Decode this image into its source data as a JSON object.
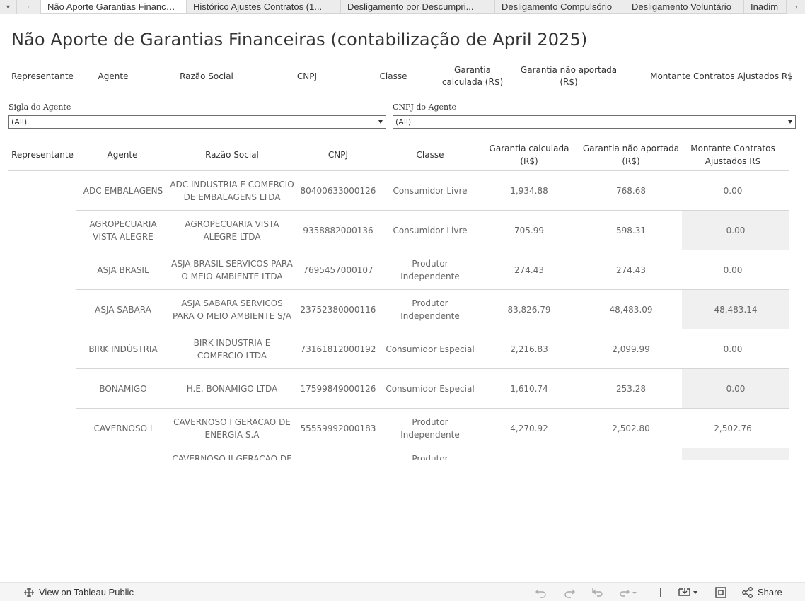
{
  "tabs": [
    {
      "label": "Não Aporte Garantias Financei..."
    },
    {
      "label": "Histórico Ajustes Contratos (1..."
    },
    {
      "label": "Desligamento por Descumpri..."
    },
    {
      "label": "Desligamento Compulsório"
    },
    {
      "label": "Desligamento Voluntário"
    },
    {
      "label": "Inadim"
    }
  ],
  "tabbar": {
    "menu_icon": "▾",
    "prev_icon": "‹",
    "next_icon": "›"
  },
  "title": "Não Aporte de Garantias Financeiras (contabilização de April 2025)",
  "summary_headers": [
    "Representante",
    "Agente",
    "Razão Social",
    "CNPJ",
    "Classe",
    "Garantia calculada (R$)",
    "Garantia não aportada (R$)",
    "Montante Contratos Ajustados R$"
  ],
  "filters": [
    {
      "label": "Sigla do Agente",
      "value": "(All)"
    },
    {
      "label": "CNPJ do Agente",
      "value": "(All)"
    }
  ],
  "table": {
    "headers": [
      "Representante",
      "Agente",
      "Razão Social",
      "CNPJ",
      "Classe",
      "Garantia calculada (R$)",
      "Garantia não aportada (R$)",
      "Montante Contratos Ajustados R$"
    ],
    "rows": [
      {
        "agente": "ADC EMBALAGENS",
        "razao": "ADC INDUSTRIA E COMERCIO DE EMBALAGENS LTDA",
        "cnpj": "80400633000126",
        "classe": "Consumidor Livre",
        "garantia": "1,934.88",
        "nao_aportada": "768.68",
        "montante": "0.00"
      },
      {
        "agente": "AGROPECUARIA VISTA ALEGRE",
        "razao": "AGROPECUARIA VISTA ALEGRE LTDA",
        "cnpj": "9358882000136",
        "classe": "Consumidor Livre",
        "garantia": "705.99",
        "nao_aportada": "598.31",
        "montante": "0.00"
      },
      {
        "agente": "ASJA BRASIL",
        "razao": "ASJA BRASIL SERVICOS PARA O MEIO AMBIENTE LTDA",
        "cnpj": "7695457000107",
        "classe": "Produtor Independente",
        "garantia": "274.43",
        "nao_aportada": "274.43",
        "montante": "0.00"
      },
      {
        "agente": "ASJA SABARA",
        "razao": "ASJA SABARA SERVICOS PARA O MEIO AMBIENTE S/A",
        "cnpj": "23752380000116",
        "classe": "Produtor Independente",
        "garantia": "83,826.79",
        "nao_aportada": "48,483.09",
        "montante": "48,483.14"
      },
      {
        "agente": "BIRK INDÚSTRIA",
        "razao": "BIRK INDUSTRIA E COMERCIO LTDA",
        "cnpj": "73161812000192",
        "classe": "Consumidor Especial",
        "garantia": "2,216.83",
        "nao_aportada": "2,099.99",
        "montante": "0.00"
      },
      {
        "agente": "BONAMIGO",
        "razao": "H.E. BONAMIGO LTDA",
        "cnpj": "17599849000126",
        "classe": "Consumidor Especial",
        "garantia": "1,610.74",
        "nao_aportada": "253.28",
        "montante": "0.00"
      },
      {
        "agente": "CAVERNOSO I",
        "razao": "CAVERNOSO I GERACAO DE ENERGIA S.A",
        "cnpj": "55559992000183",
        "classe": "Produtor Independente",
        "garantia": "4,270.92",
        "nao_aportada": "2,502.80",
        "montante": "2,502.76"
      },
      {
        "agente": "",
        "razao": "CAVERNOSO II GERACAO DE",
        "cnpj": "",
        "classe": "Produtor",
        "garantia": "",
        "nao_aportada": "",
        "montante": ""
      }
    ]
  },
  "toolbar": {
    "view_label": "View on Tableau Public",
    "share_label": "Share",
    "icons": [
      "tableau-icon",
      "undo-icon",
      "redo-icon",
      "revert-icon",
      "refresh-icon",
      "download-icon",
      "fullscreen-icon",
      "share-icon"
    ]
  }
}
